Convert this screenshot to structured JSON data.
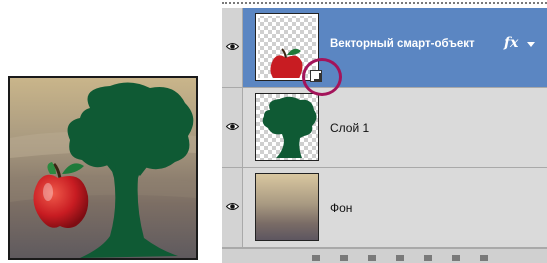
{
  "layers_panel": {
    "layers": [
      {
        "name": "Векторный смарт-объект",
        "selected": true,
        "visible": true,
        "thumbnail": "apple",
        "has_effects": true,
        "effects_icon": "fx",
        "smart_object_badge": true
      },
      {
        "name": "Слой 1",
        "selected": false,
        "visible": true,
        "thumbnail": "tree"
      },
      {
        "name": "Фон",
        "selected": false,
        "visible": true,
        "thumbnail": "landscape-photo"
      }
    ],
    "highlight": "smart-object-badge",
    "colors": {
      "selected_row": "#5b86c2",
      "callout": "#a3145a",
      "tree": "#0f5a34",
      "apple": "#c81c22"
    }
  },
  "canvas_preview": {
    "content": [
      "landscape-background",
      "tree-silhouette",
      "red-apple"
    ]
  }
}
